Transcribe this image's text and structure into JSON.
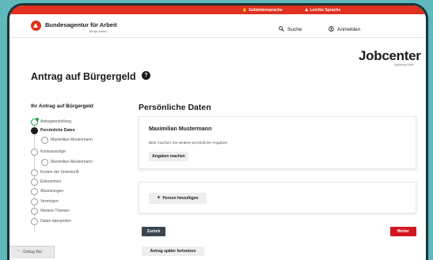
{
  "topbar": {
    "sign_language": "Gebärdensprache",
    "easy_language": "Leichte Sprache",
    "color": "#e0301e"
  },
  "header": {
    "org_name": "Bundesagentur für Arbeit",
    "org_tagline": "bringt weiter.",
    "search_label": "Suche",
    "login_label": "Anmelden"
  },
  "brand": {
    "name": "Jobcenter",
    "location": "Augsburg-Stadt"
  },
  "page": {
    "title": "Antrag auf Bürgergeld",
    "help_symbol": "?"
  },
  "sidebar": {
    "title": "Ihr Antrag auf Bürgergeld",
    "steps": [
      {
        "label": "Antragserstellung",
        "state": "done"
      },
      {
        "label": "Persönliche Daten",
        "state": "active"
      },
      {
        "label": "Maximilian Mustermann",
        "state": "sub"
      },
      {
        "label": "Kontoauszüge",
        "state": "open"
      },
      {
        "label": "Maximilian Mustermann",
        "state": "sub"
      },
      {
        "label": "Kosten der Unterkunft",
        "state": "open"
      },
      {
        "label": "Einkommen",
        "state": "open"
      },
      {
        "label": "Absetzungen",
        "state": "open"
      },
      {
        "label": "Vermögen",
        "state": "open"
      },
      {
        "label": "Weitere Themen",
        "state": "open"
      },
      {
        "label": "Daten überprüfen",
        "state": "open"
      }
    ]
  },
  "debug_bar": {
    "label": "Debug-Bar"
  },
  "main": {
    "section_title": "Persönliche Daten",
    "person_card": {
      "name": "Maximilian Mustermann",
      "hint": "Bitte machen Sie weitere persönliche Angaben",
      "button": "Angaben machen"
    },
    "add_card": {
      "button": "Person hinzufügen"
    },
    "back_button": "Zurück",
    "next_button": "Weiter",
    "later_button": "Antrag später fortsetzen"
  }
}
